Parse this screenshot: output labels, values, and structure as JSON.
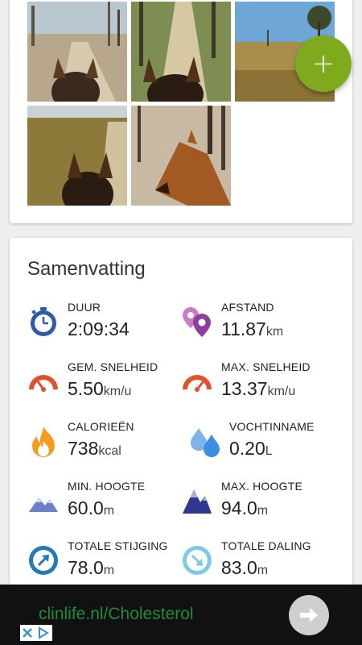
{
  "photos": [
    {
      "name": "photo-trail-1"
    },
    {
      "name": "photo-trail-2"
    },
    {
      "name": "photo-heath"
    },
    {
      "name": "photo-trail-3"
    },
    {
      "name": "photo-horse-head"
    }
  ],
  "fab": {
    "icon": "plus-icon",
    "label": "+"
  },
  "summary": {
    "title": "Samenvatting",
    "stats": [
      {
        "icon": "stopwatch-icon",
        "label": "DUUR",
        "value": "2:09:34",
        "unit": ""
      },
      {
        "icon": "location-pins-icon",
        "label": "AFSTAND",
        "value": "11.87",
        "unit": "km"
      },
      {
        "icon": "speedometer-icon",
        "label": "GEM. SNELHEID",
        "value": "5.50",
        "unit": "km/u"
      },
      {
        "icon": "speedometer-max-icon",
        "label": "MAX. SNELHEID",
        "value": "13.37",
        "unit": "km/u"
      },
      {
        "icon": "flame-icon",
        "label": "CALORIEËN",
        "value": "738",
        "unit": "kcal"
      },
      {
        "icon": "water-drops-icon",
        "label": "VOCHTINNAME",
        "value": "0.20",
        "unit": "L"
      },
      {
        "icon": "mountain-min-icon",
        "label": "MIN. HOOGTE",
        "value": "60.0",
        "unit": "m"
      },
      {
        "icon": "mountain-max-icon",
        "label": "MAX. HOOGTE",
        "value": "94.0",
        "unit": "m"
      },
      {
        "icon": "ascent-arrow-icon",
        "label": "TOTALE STIJGING",
        "value": "78.0",
        "unit": "m"
      },
      {
        "icon": "descent-arrow-icon",
        "label": "TOTALE DALING",
        "value": "83.0",
        "unit": "m"
      }
    ]
  },
  "ad": {
    "text": "clinlife.nl/Cholesterol",
    "arrow_icon": "arrow-right-icon",
    "choices_icon": "ad-choices-icon"
  },
  "colors": {
    "accent": "#7faa1e",
    "stopwatch": "#2e5aa6",
    "pins": "#8e3f9e",
    "speedo": "#e0522a",
    "flame": "#f39a1f",
    "drops": "#3b8ee0",
    "mountain_min": "#6c7fcf",
    "mountain_max": "#2f3a8f",
    "ascent": "#1f7ab5",
    "descent": "#7ec9e6",
    "ad_text": "#1f8c3c"
  }
}
